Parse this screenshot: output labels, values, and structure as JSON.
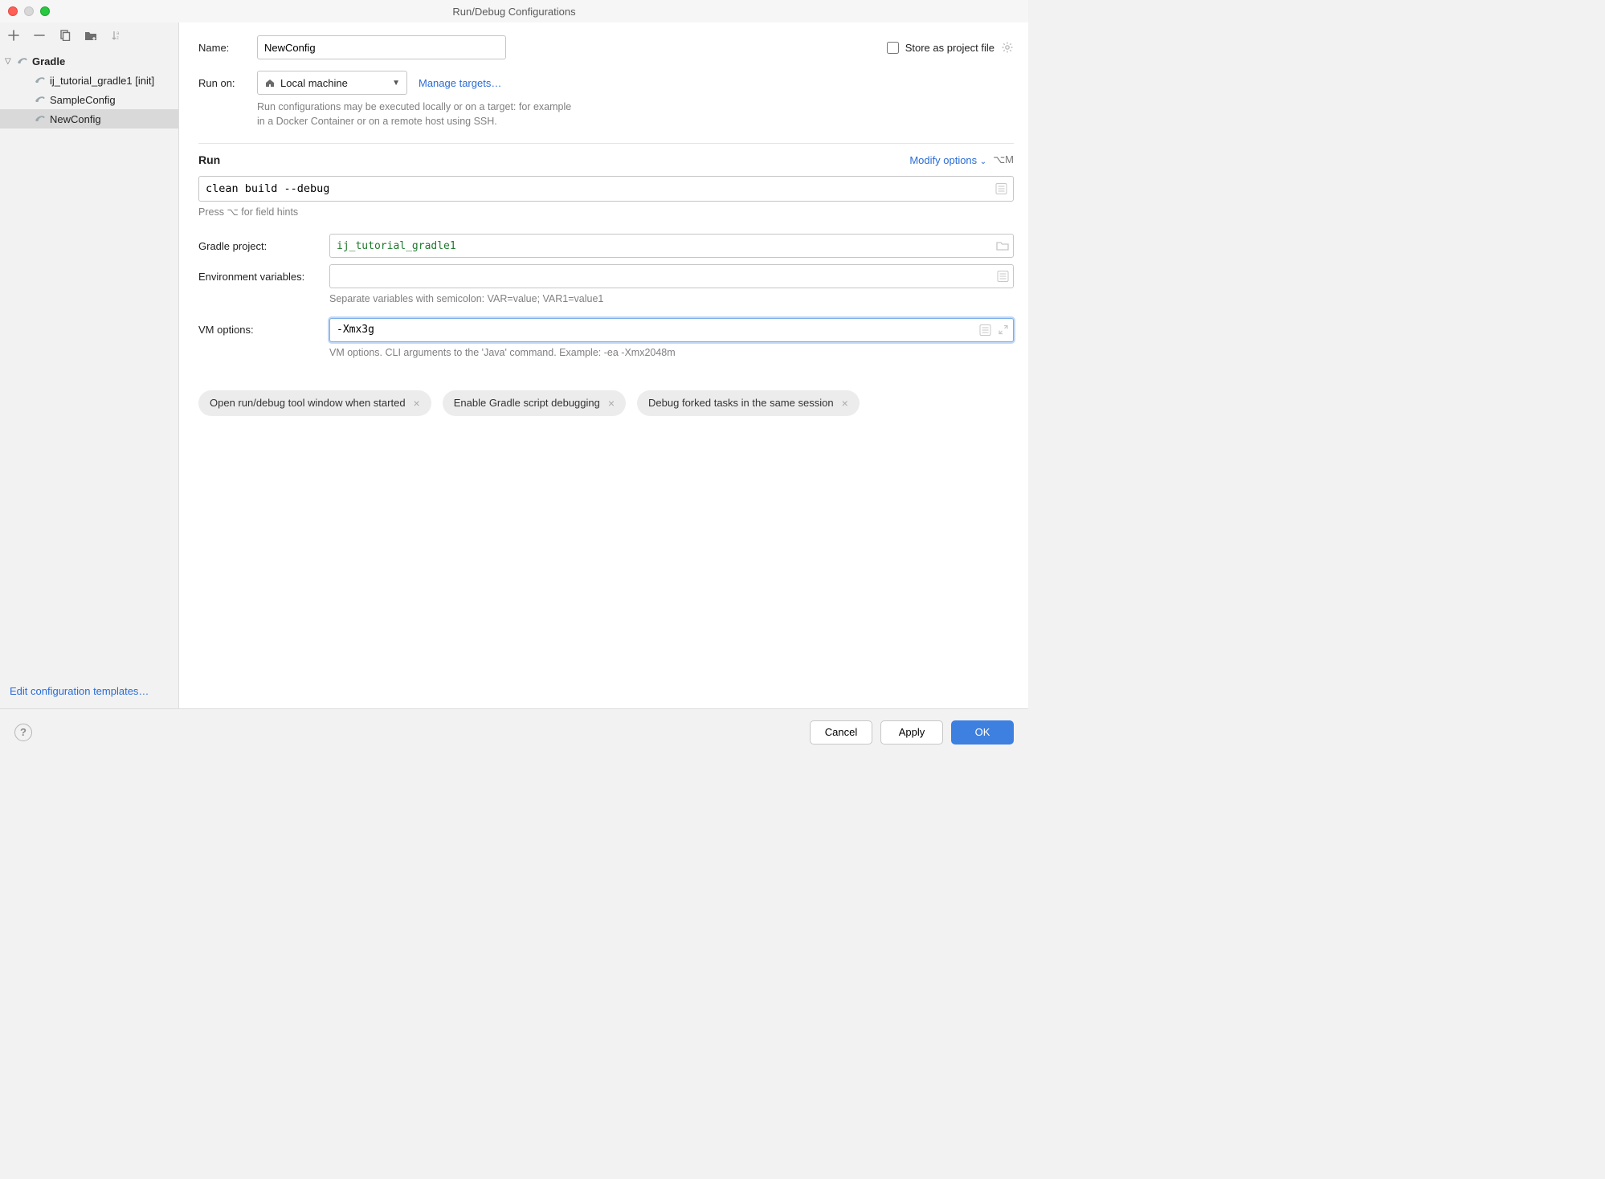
{
  "window": {
    "title": "Run/Debug Configurations"
  },
  "sidebar": {
    "root": {
      "label": "Gradle"
    },
    "items": [
      {
        "label": "ij_tutorial_gradle1 [init]"
      },
      {
        "label": "SampleConfig"
      },
      {
        "label": "NewConfig"
      }
    ],
    "footer_link": "Edit configuration templates…"
  },
  "form": {
    "name_label": "Name:",
    "name_value": "NewConfig",
    "store_label": "Store as project file",
    "runon_label": "Run on:",
    "runon_value": "Local machine",
    "manage_targets": "Manage targets…",
    "runon_hint1": "Run configurations may be executed locally or on a target: for example",
    "runon_hint2": "in a Docker Container or on a remote host using SSH."
  },
  "run": {
    "section_title": "Run",
    "modify_options": "Modify options",
    "shortcut": "⌥M",
    "tasks_value": "clean build --debug",
    "tasks_hint": "Press ⌥ for field hints",
    "gradle_project_label": "Gradle project:",
    "gradle_project_value": "ij_tutorial_gradle1",
    "env_label": "Environment variables:",
    "env_value": "",
    "env_hint": "Separate variables with semicolon: VAR=value; VAR1=value1",
    "vm_label": "VM options:",
    "vm_value": "-Xmx3g",
    "vm_hint": "VM options. CLI arguments to the 'Java' command. Example: -ea -Xmx2048m"
  },
  "chips": [
    "Open run/debug tool window when started",
    "Enable Gradle script debugging",
    "Debug forked tasks in the same session"
  ],
  "footer": {
    "cancel": "Cancel",
    "apply": "Apply",
    "ok": "OK"
  }
}
